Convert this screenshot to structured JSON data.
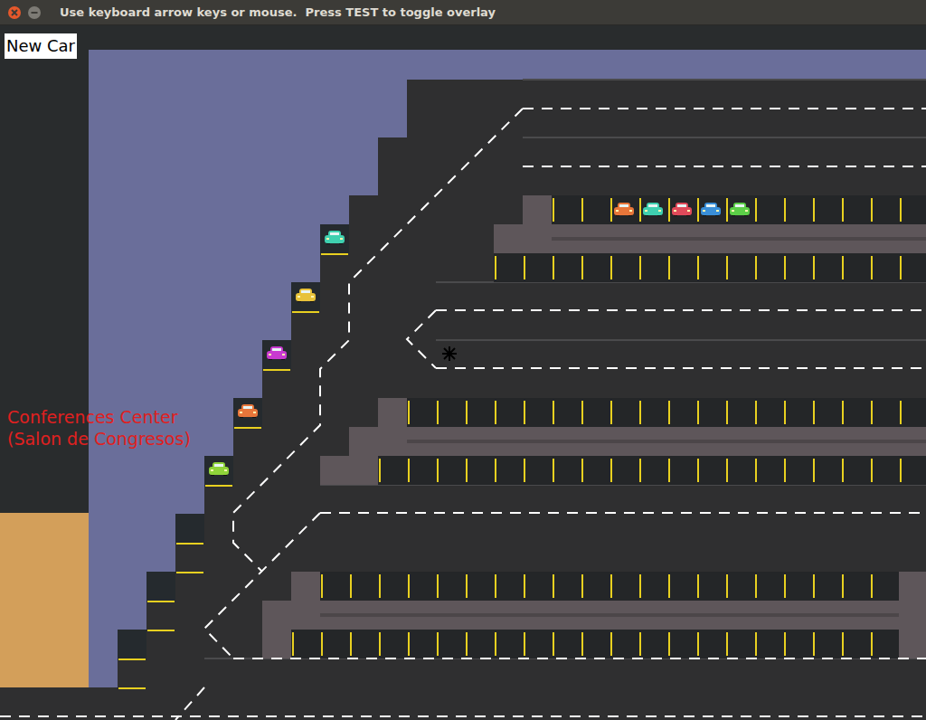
{
  "window": {
    "title": "Use keyboard arrow keys or mouse.  Press TEST to toggle overlay"
  },
  "buttons": [
    {
      "label": "New Car"
    }
  ],
  "map": {
    "labels": [
      "Conferences Center",
      "(Salon de Congresos)"
    ]
  },
  "parked_cars": [
    {
      "color": "#e8763a"
    },
    {
      "color": "#3fd0b0"
    },
    {
      "color": "#e04a5a"
    },
    {
      "color": "#3a8fd8"
    },
    {
      "color": "#5ccf48"
    }
  ],
  "ramp_cars": [
    {
      "color": "#3fd0b0"
    },
    {
      "color": "#e8c23a"
    },
    {
      "color": "#c83ad0"
    },
    {
      "color": "#e8763a"
    },
    {
      "color": "#8fd43a"
    }
  ]
}
